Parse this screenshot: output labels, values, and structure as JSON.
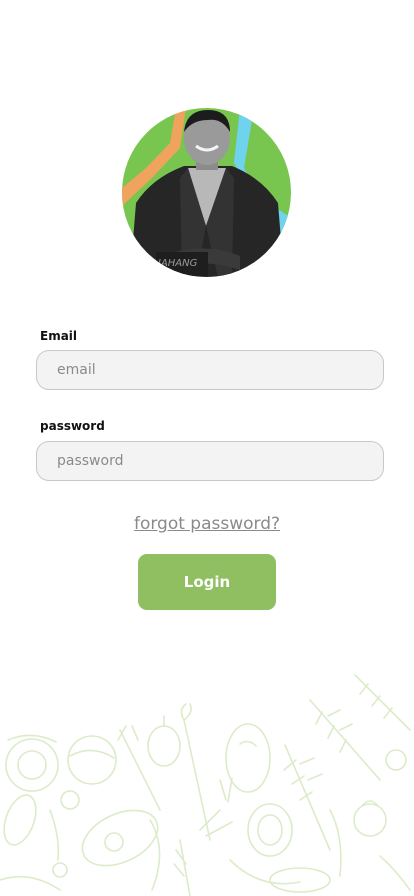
{
  "profile": {
    "avatar_caption": "JAHANG"
  },
  "form": {
    "email_label": "Email",
    "email_placeholder": "email",
    "email_value": "",
    "password_label": "password",
    "password_placeholder": "password",
    "password_value": "",
    "forgot_label": "forgot password?",
    "login_label": "Login"
  },
  "colors": {
    "accent": "#8fbf61",
    "input_background": "#f3f3f3",
    "avatar_background": "#78c64f",
    "pattern_stroke": "#dcebc9"
  }
}
